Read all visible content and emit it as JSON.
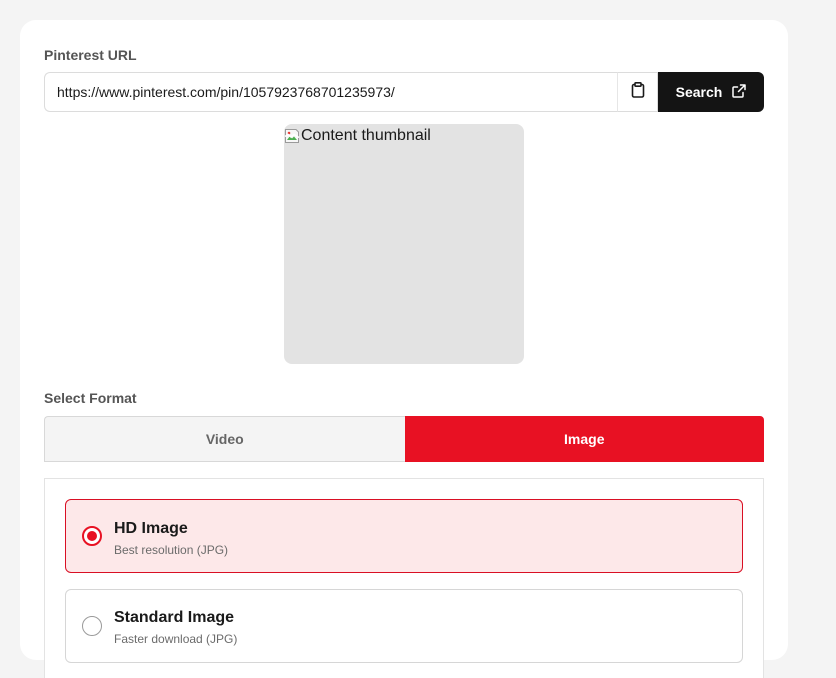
{
  "url_section": {
    "label": "Pinterest URL",
    "value": "https://www.pinterest.com/pin/1057923768701235973/",
    "paste_icon": "clipboard-icon",
    "search_label": "Search",
    "search_icon": "external-link-icon"
  },
  "thumbnail": {
    "alt_text": "Content thumbnail",
    "icon": "broken-image-icon"
  },
  "format_section": {
    "label": "Select Format",
    "tabs": [
      {
        "label": "Video",
        "selected": false
      },
      {
        "label": "Image",
        "selected": true
      }
    ]
  },
  "options": [
    {
      "title": "HD Image",
      "subtitle": "Best resolution (JPG)",
      "selected": true
    },
    {
      "title": "Standard Image",
      "subtitle": "Faster download (JPG)",
      "selected": false
    }
  ],
  "colors": {
    "accent": "#e81123",
    "accent_light": "#fde8e9",
    "button_dark": "#141414",
    "page_bg": "#f4f4f4"
  }
}
